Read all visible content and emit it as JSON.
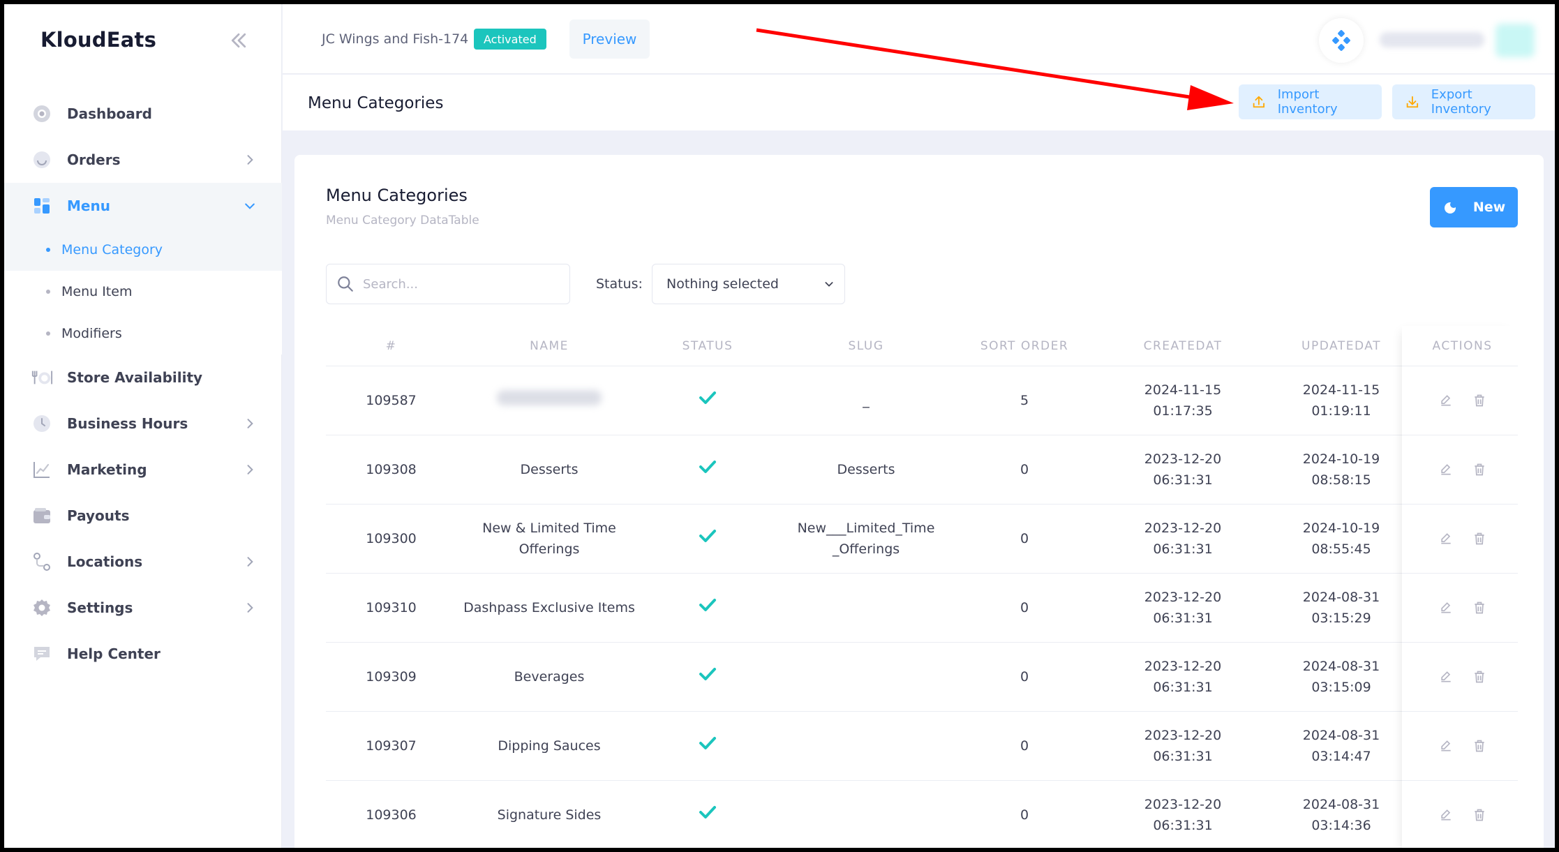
{
  "brand": "KloudEats",
  "sidebar": {
    "items": [
      {
        "label": "Dashboard",
        "icon": "dashboard-icon"
      },
      {
        "label": "Orders",
        "icon": "orders-icon"
      },
      {
        "label": "Menu",
        "icon": "menu-icon"
      },
      {
        "label": "Store Availability",
        "icon": "utensils-icon"
      },
      {
        "label": "Business Hours",
        "icon": "clock-icon"
      },
      {
        "label": "Marketing",
        "icon": "chart-icon"
      },
      {
        "label": "Payouts",
        "icon": "wallet-icon"
      },
      {
        "label": "Locations",
        "icon": "location-icon"
      },
      {
        "label": "Settings",
        "icon": "gear-icon"
      },
      {
        "label": "Help Center",
        "icon": "chat-icon"
      }
    ],
    "menu_sub": [
      "Menu Category",
      "Menu Item",
      "Modifiers"
    ]
  },
  "header": {
    "store_name": "JC Wings and Fish-174",
    "status": "Activated",
    "preview": "Preview"
  },
  "subheader": {
    "title": "Menu Categories",
    "import_label": "Import Inventory",
    "export_label": "Export Inventory"
  },
  "card": {
    "title": "Menu Categories",
    "subtitle": "Menu Category DataTable",
    "new_label": "New",
    "search_placeholder": "Search...",
    "status_label": "Status:",
    "status_value": "Nothing selected"
  },
  "table": {
    "columns": [
      "#",
      "NAME",
      "STATUS",
      "SLUG",
      "SORT ORDER",
      "CREATEDAT",
      "UPDATEDAT",
      "ACTIONS"
    ],
    "rows": [
      {
        "id": "109587",
        "name": "",
        "slug": "_",
        "sort": "5",
        "created_date": "2024-11-15",
        "created_time": "01:17:35",
        "updated_date": "2024-11-15",
        "updated_time": "01:19:11"
      },
      {
        "id": "109308",
        "name": "Desserts",
        "slug": "Desserts",
        "sort": "0",
        "created_date": "2023-12-20",
        "created_time": "06:31:31",
        "updated_date": "2024-10-19",
        "updated_time": "08:58:15"
      },
      {
        "id": "109300",
        "name": "New & Limited Time Offerings",
        "slug": "New___Limited_Time _Offerings",
        "sort": "0",
        "created_date": "2023-12-20",
        "created_time": "06:31:31",
        "updated_date": "2024-10-19",
        "updated_time": "08:55:45"
      },
      {
        "id": "109310",
        "name": "Dashpass Exclusive Items",
        "slug": "",
        "sort": "0",
        "created_date": "2023-12-20",
        "created_time": "06:31:31",
        "updated_date": "2024-08-31",
        "updated_time": "03:15:29"
      },
      {
        "id": "109309",
        "name": "Beverages",
        "slug": "",
        "sort": "0",
        "created_date": "2023-12-20",
        "created_time": "06:31:31",
        "updated_date": "2024-08-31",
        "updated_time": "03:15:09"
      },
      {
        "id": "109307",
        "name": "Dipping Sauces",
        "slug": "",
        "sort": "0",
        "created_date": "2023-12-20",
        "created_time": "06:31:31",
        "updated_date": "2024-08-31",
        "updated_time": "03:14:47"
      },
      {
        "id": "109306",
        "name": "Signature Sides",
        "slug": "",
        "sort": "0",
        "created_date": "2023-12-20",
        "created_time": "06:31:31",
        "updated_date": "2024-08-31",
        "updated_time": "03:14:36"
      }
    ]
  },
  "colors": {
    "accent": "#3699ff",
    "success": "#1bc5bd",
    "annotation_arrow": "#ff0000"
  }
}
